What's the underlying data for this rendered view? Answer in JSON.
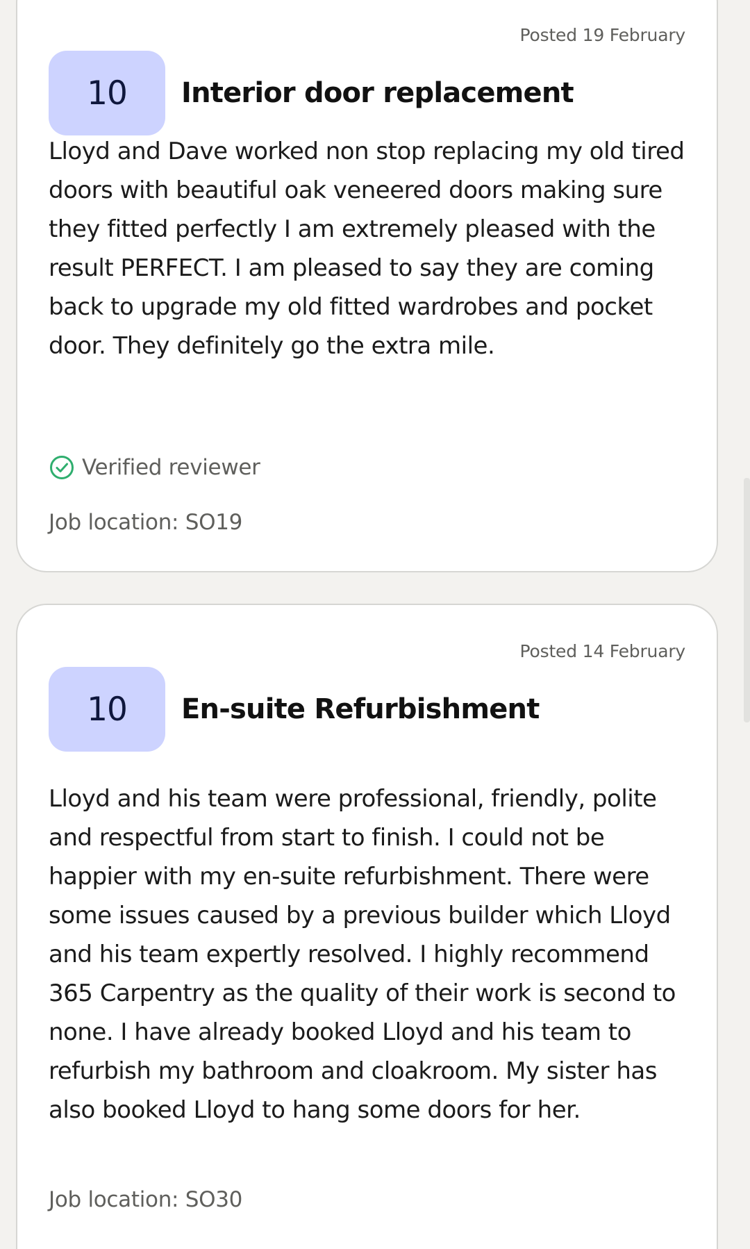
{
  "reviews": [
    {
      "posted": "Posted 19 February",
      "score": "10",
      "title": "Interior door replacement",
      "body": "Lloyd and Dave worked non stop replacing my old tired doors with beautiful oak veneered doors making sure they fitted perfectly I am extremely pleased with the result PERFECT. I am pleased to say they are coming back to upgrade my old fitted wardrobes and pocket door. They definitely go the extra mile.",
      "verified_label": "Verified reviewer",
      "job_location": "Job location: SO19"
    },
    {
      "posted": "Posted 14 February",
      "score": "10",
      "title": "En-suite Refurbishment",
      "body": "Lloyd and his team were professional, friendly, polite and respectful from start to finish. I could not be happier with my en-suite refurbishment. There were some issues caused by a previous builder which Lloyd and his team expertly resolved. I highly recommend 365 Carpentry as the quality of their work is second to none. I have already booked Lloyd and his team to refurbish my bathroom and cloakroom. My sister has also booked Lloyd to hang some doors for her.",
      "job_location": "Job location: SO30"
    }
  ],
  "icons": {
    "verified": "check-circle-icon"
  },
  "colors": {
    "score_badge_bg": "#cdd3ff",
    "score_text": "#0f173d",
    "verified_check": "#2fae6e",
    "page_bg": "#f3f2ef",
    "card_border": "#d6d6d3"
  }
}
